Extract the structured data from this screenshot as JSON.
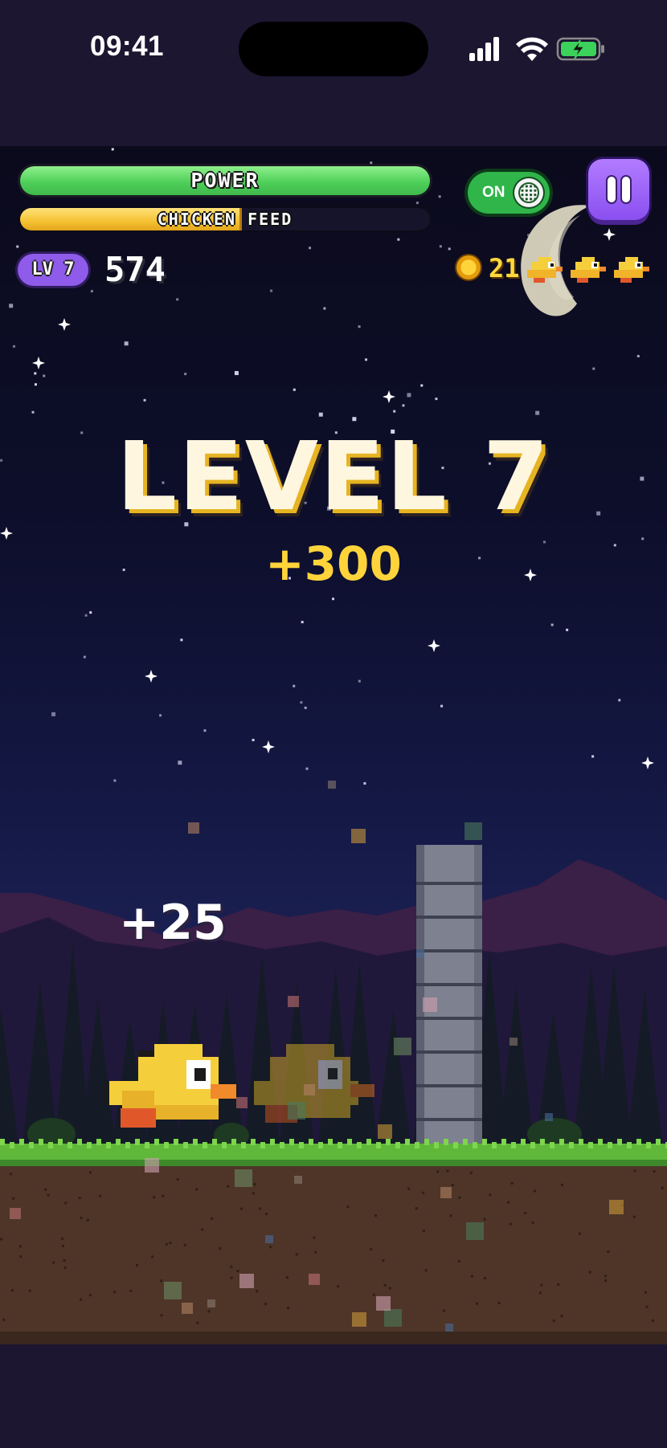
{
  "status_bar": {
    "time": "09:41",
    "icons": [
      "signal-icon",
      "wifi-icon",
      "battery-charging-icon"
    ]
  },
  "hud": {
    "power": {
      "label": "POWER",
      "fill": 1.0
    },
    "feed": {
      "label": "CHICKEN FEED",
      "fill": 0.54
    },
    "sound_toggle": {
      "label": "ON",
      "state": "on"
    },
    "pause_icon": "pause-icon",
    "level_badge": "LV 7",
    "score": "574",
    "coins": "21",
    "lives": 3
  },
  "overlay": {
    "level_title": "LEVEL 7",
    "level_bonus": "+300",
    "score_popup": "+25"
  },
  "colors": {
    "power": "#4fd05a",
    "feed": "#f5c232",
    "pause_button": "#8a4ff0",
    "coin": "#ffd43b",
    "sky_top": "#0b0a1c",
    "dirt": "#4e3528",
    "grass": "#5fb83a",
    "chick": "#f5cf3b"
  }
}
